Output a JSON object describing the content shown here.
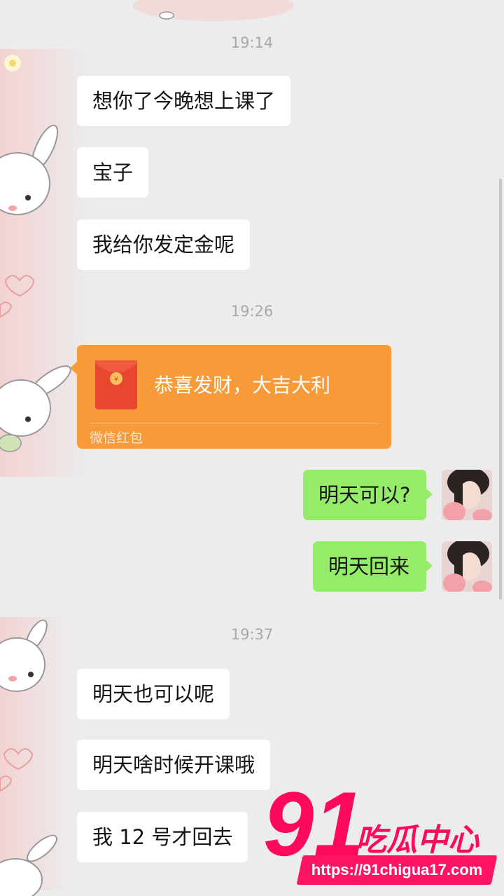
{
  "times": [
    "19:14",
    "19:26",
    "19:37"
  ],
  "messages": {
    "m1": "想你了今晚想上课了",
    "m2": "宝子",
    "m3": "我给你发定金呢",
    "r1": "明天可以?",
    "r2": "明天回来",
    "m4": "明天也可以呢",
    "m5": "明天啥时候开课哦",
    "m6": "我 12 号才回去"
  },
  "red_packet": {
    "title": "恭喜发财，大吉大利",
    "footer": "微信红包",
    "icon": "red-envelope-icon"
  },
  "watermark": {
    "number": "91",
    "name": "吃瓜中心",
    "url": "https://91chigua17.com"
  },
  "colors": {
    "background": "#ececec",
    "incoming_bubble": "#ffffff",
    "outgoing_bubble": "#95ec69",
    "red_packet": "#f79a3a",
    "watermark": "#ff0a5a"
  }
}
